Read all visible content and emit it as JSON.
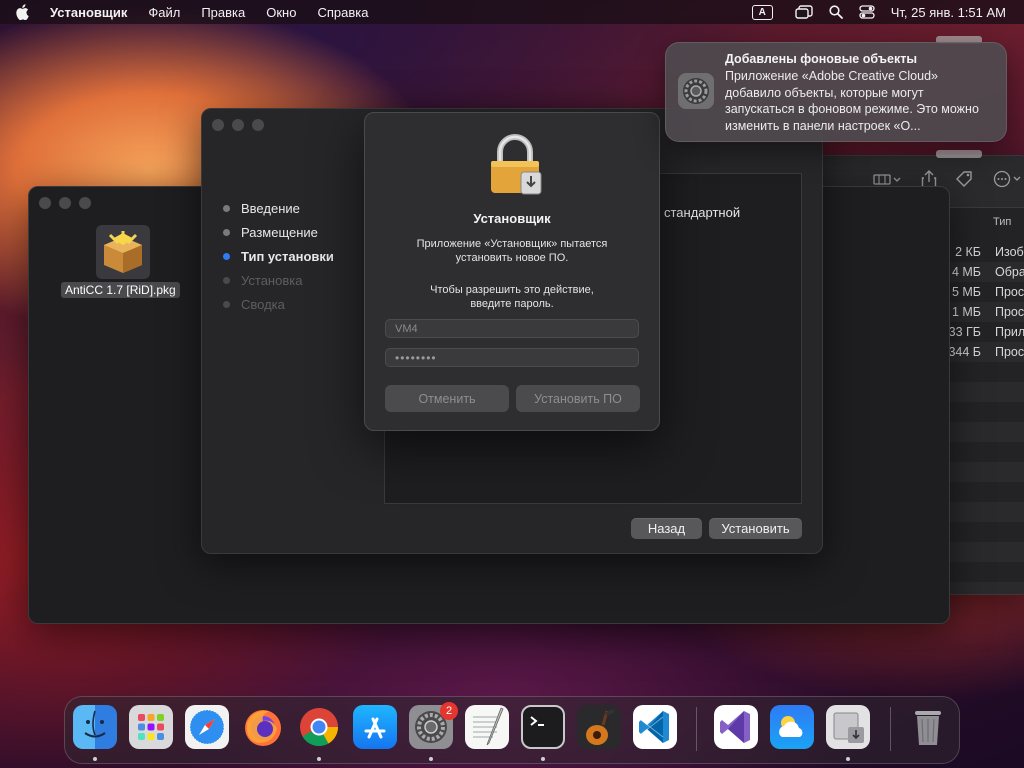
{
  "menubar": {
    "app_name": "Установщик",
    "items": [
      "Файл",
      "Правка",
      "Окно",
      "Справка"
    ],
    "input_source": "A",
    "clock": "Чт, 25 янв.  1:51 AM"
  },
  "notification": {
    "title": "Добавлены фоновые объекты",
    "body": "Приложение «Adobe Creative Cloud» добавило объекты, которые могут запускаться в фоновом режиме. Это можно изменить в панели настроек «О..."
  },
  "finder": {
    "column_kind": "Тип",
    "rows": [
      {
        "size": "2 КБ",
        "kind": "Изоб"
      },
      {
        "size": "4 МБ",
        "kind": "Обра"
      },
      {
        "size": "5 МБ",
        "kind": "Прос"
      },
      {
        "size": "1 МБ",
        "kind": "Прос"
      },
      {
        "size": "33 ГБ",
        "kind": "Прил"
      },
      {
        "size": "344 Б",
        "kind": "Прос"
      }
    ]
  },
  "desktop": {
    "file_label": "AntiCC 1.7 [RiD].pkg"
  },
  "installer": {
    "steps": [
      {
        "label": "Введение",
        "state": "done"
      },
      {
        "label": "Размещение",
        "state": "done"
      },
      {
        "label": "Тип установки",
        "state": "active"
      },
      {
        "label": "Установка",
        "state": "disabled"
      },
      {
        "label": "Сводка",
        "state": "disabled"
      }
    ],
    "content_text": "стандартной",
    "back_label": "Назад",
    "install_label": "Установить"
  },
  "auth": {
    "title": "Установщик",
    "message1_line1": "Приложение «Установщик» пытается",
    "message1_line2": "установить новое ПО.",
    "message2_line1": "Чтобы разрешить это действие,",
    "message2_line2": "введите пароль.",
    "username": "VM4",
    "password_mask": "••••••••",
    "cancel_label": "Отменить",
    "install_label": "Установить ПО"
  },
  "dock": {
    "badge_count": "2",
    "apps": [
      "Finder",
      "Launchpad",
      "Safari",
      "Firefox",
      "Chrome",
      "App Store",
      "System Settings",
      "TextEdit",
      "Terminal",
      "GarageBand",
      "VS Code",
      "Visual Studio",
      "Weather",
      "Installer",
      "Trash"
    ]
  },
  "colors": {
    "accent": "#2f7bf5",
    "badge": "#e5352f"
  }
}
